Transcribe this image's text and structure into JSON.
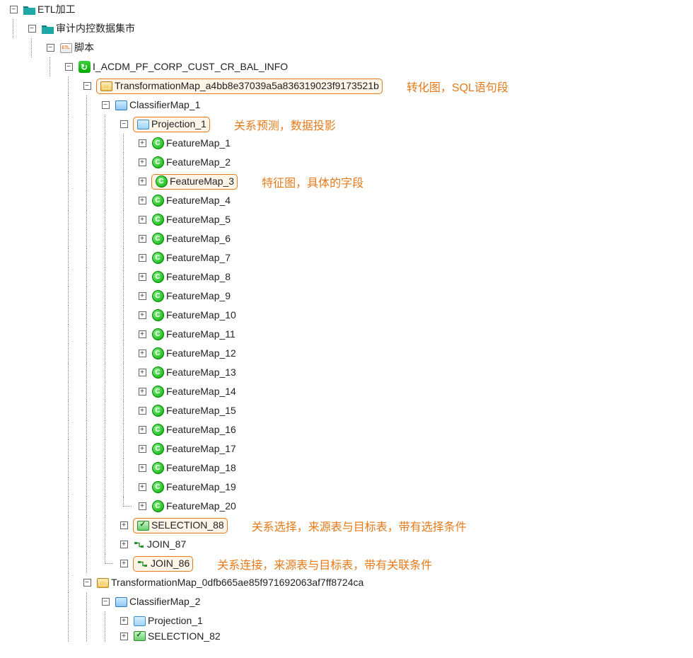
{
  "tree": {
    "root": {
      "label": "ETL加工"
    },
    "l1": {
      "label": "审计内控数据集市"
    },
    "l2": {
      "label": "脚本"
    },
    "l3": {
      "label": "I_ACDM_PF_CORP_CUST_CR_BAL_INFO"
    },
    "tm1": {
      "label": "TransformationMap_a4bb8e37039a5a836319023f9173521b"
    },
    "cm1": {
      "label": "ClassifierMap_1"
    },
    "pj1": {
      "label": "Projection_1"
    },
    "fm": [
      {
        "label": "FeatureMap_1"
      },
      {
        "label": "FeatureMap_2"
      },
      {
        "label": "FeatureMap_3"
      },
      {
        "label": "FeatureMap_4"
      },
      {
        "label": "FeatureMap_5"
      },
      {
        "label": "FeatureMap_6"
      },
      {
        "label": "FeatureMap_7"
      },
      {
        "label": "FeatureMap_8"
      },
      {
        "label": "FeatureMap_9"
      },
      {
        "label": "FeatureMap_10"
      },
      {
        "label": "FeatureMap_11"
      },
      {
        "label": "FeatureMap_12"
      },
      {
        "label": "FeatureMap_13"
      },
      {
        "label": "FeatureMap_14"
      },
      {
        "label": "FeatureMap_15"
      },
      {
        "label": "FeatureMap_16"
      },
      {
        "label": "FeatureMap_17"
      },
      {
        "label": "FeatureMap_18"
      },
      {
        "label": "FeatureMap_19"
      },
      {
        "label": "FeatureMap_20"
      }
    ],
    "sel88": {
      "label": "SELECTION_88"
    },
    "join87": {
      "label": "JOIN_87"
    },
    "join86": {
      "label": "JOIN_86"
    },
    "tm2": {
      "label": "TransformationMap_0dfb665ae85f971692063af7ff8724ca"
    },
    "cm2": {
      "label": "ClassifierMap_2"
    },
    "pj2": {
      "label": "Projection_1"
    },
    "sel82": {
      "label": "SELECTION_82"
    }
  },
  "annotations": {
    "tm": "转化图，SQL语句段",
    "pj": "关系预测，数据投影",
    "fm": "特征图，具体的字段",
    "sel": "关系选择，来源表与目标表，带有选择条件",
    "join": "关系连接，来源表与目标表，带有关联条件"
  },
  "glyph": {
    "plus": "+",
    "minus": "−",
    "c": "C"
  }
}
